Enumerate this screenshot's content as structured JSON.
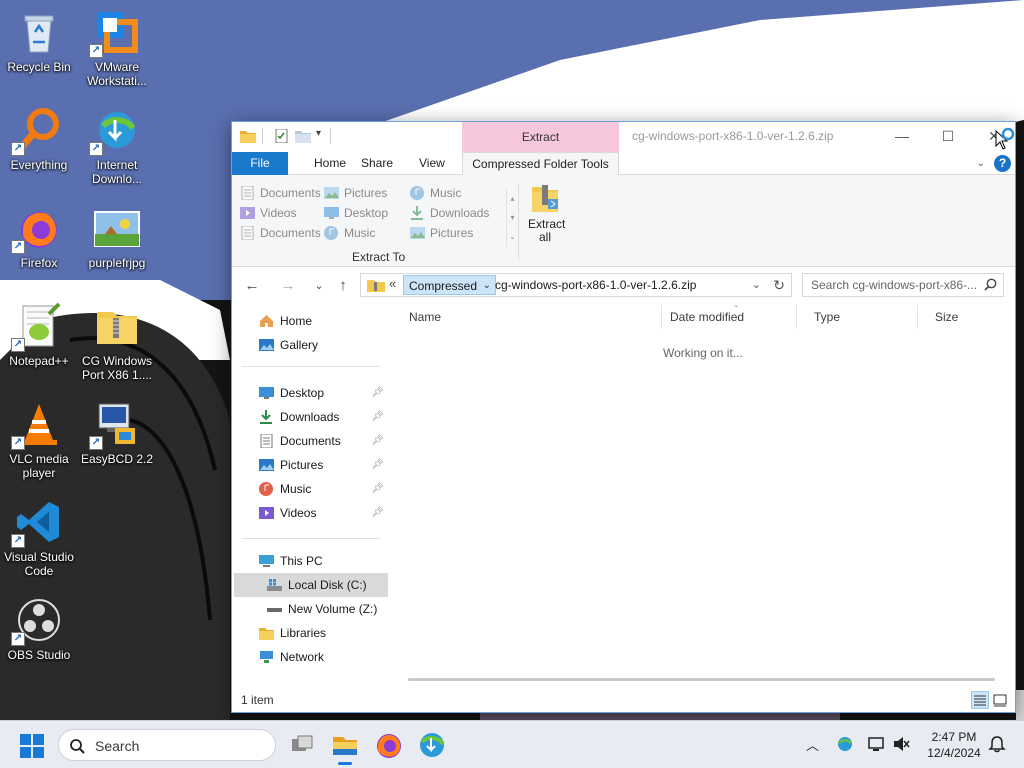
{
  "desktop": {
    "icons": [
      {
        "label": "Recycle Bin",
        "icon": "recycle-bin-icon"
      },
      {
        "label": "VMware Workstati...",
        "icon": "vmware-icon"
      },
      {
        "label": "Everything",
        "icon": "everything-search-icon"
      },
      {
        "label": "Internet Downlo...",
        "icon": "internet-download-manager-icon"
      },
      {
        "label": "Firefox",
        "icon": "firefox-icon"
      },
      {
        "label": "purplefrjpg",
        "icon": "image-file-icon"
      },
      {
        "label": "Notepad++",
        "icon": "notepadpp-icon"
      },
      {
        "label": "CG Windows Port X86 1....",
        "icon": "zip-folder-icon"
      },
      {
        "label": "VLC media player",
        "icon": "vlc-icon"
      },
      {
        "label": "EasyBCD 2.2",
        "icon": "easybcd-icon"
      },
      {
        "label": "Visual Studio Code",
        "icon": "vscode-icon"
      },
      {
        "label": "OBS Studio",
        "icon": "obs-icon"
      }
    ]
  },
  "explorer": {
    "context_tab_header": "Extract",
    "window_title": "cg-windows-port-x86-1.0-ver-1.2.6.zip",
    "caption": {
      "minimize": "—",
      "maximize": "☐",
      "close": "✕"
    },
    "tabs": {
      "file": "File",
      "home": "Home",
      "share": "Share",
      "view": "View",
      "compressed_tools": "Compressed Folder Tools"
    },
    "ribbon": {
      "gallery": [
        [
          "Documents",
          "Pictures",
          "Music"
        ],
        [
          "Videos",
          "Desktop",
          "Downloads"
        ],
        [
          "Documents",
          "Music",
          "Pictures"
        ]
      ],
      "group_label": "Extract To",
      "extract_all_line1": "Extract",
      "extract_all_line2": "all"
    },
    "address": {
      "crumb": "Compressed",
      "chevron": "«",
      "path": "cg-windows-port-x86-1.0-ver-1.2.6.zip"
    },
    "search_placeholder": "Search cg-windows-port-x86-...",
    "nav": {
      "home": "Home",
      "gallery": "Gallery",
      "quick": [
        "Desktop",
        "Downloads",
        "Documents",
        "Pictures",
        "Music",
        "Videos"
      ],
      "this_pc": "This PC",
      "local_disk": "Local Disk (C:)",
      "new_volume": "New Volume (Z:)",
      "libraries": "Libraries",
      "network": "Network"
    },
    "columns": {
      "name": "Name",
      "date_modified": "Date modified",
      "type": "Type",
      "size": "Size"
    },
    "working_text": "Working on it...",
    "status_items": "1 item"
  },
  "taskbar": {
    "search_label": "Search",
    "time": "2:47 PM",
    "date": "12/4/2024",
    "colors": {
      "accent": "#1979ca",
      "context_pink": "#f6c6dd"
    }
  }
}
